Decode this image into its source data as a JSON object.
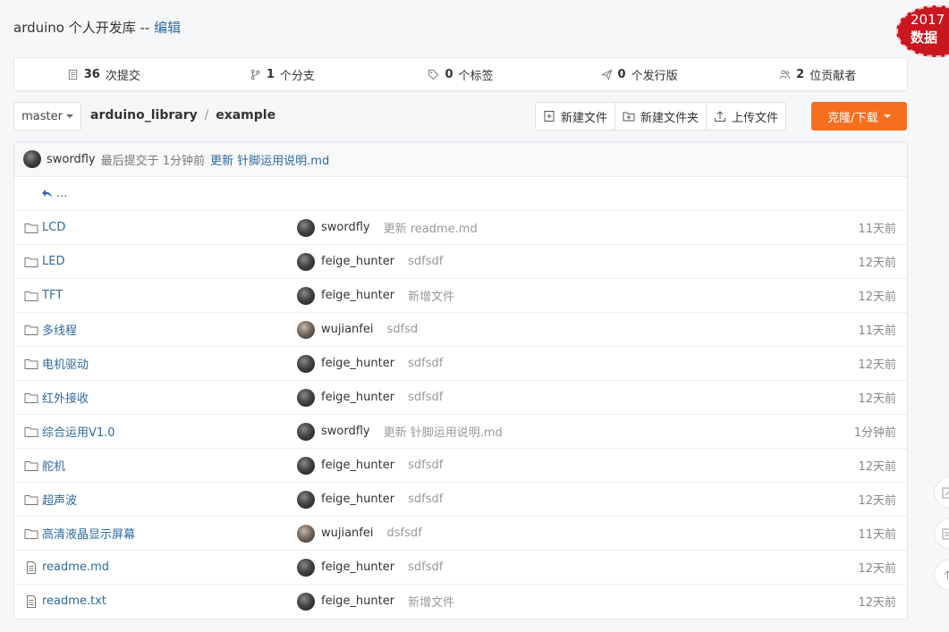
{
  "header": {
    "repo_title": "arduino 个人开发库 --",
    "edit_label": "编辑",
    "badge_year": "2017",
    "badge_text": "数据"
  },
  "stats": [
    {
      "icon": "commit-icon",
      "count": "36",
      "label": "次提交"
    },
    {
      "icon": "branch-icon",
      "count": "1",
      "label": "个分支"
    },
    {
      "icon": "tag-icon",
      "count": "0",
      "label": "个标签"
    },
    {
      "icon": "release-icon",
      "count": "0",
      "label": "个发行版"
    },
    {
      "icon": "contributors-icon",
      "count": "2",
      "label": "位贡献者"
    }
  ],
  "toolbar": {
    "branch": "master",
    "path": [
      "arduino_library",
      "example"
    ],
    "separator": "/",
    "new_file": "新建文件",
    "new_folder": "新建文件夹",
    "upload": "上传文件",
    "clone": "克隆/下载"
  },
  "last_commit": {
    "author": "swordfly",
    "prefix": "最后提交于 1分钟前",
    "message": "更新 针脚运用说明.md"
  },
  "up_label": "...",
  "files": [
    {
      "type": "folder",
      "name": "LCD",
      "author": "swordfly",
      "alt_avatar": false,
      "message": "更新 readme.md",
      "time": "11天前"
    },
    {
      "type": "folder",
      "name": "LED",
      "author": "feige_hunter",
      "alt_avatar": false,
      "message": "sdfsdf",
      "time": "12天前"
    },
    {
      "type": "folder",
      "name": "TFT",
      "author": "feige_hunter",
      "alt_avatar": false,
      "message": "新增文件",
      "time": "12天前"
    },
    {
      "type": "folder",
      "name": "多线程",
      "author": "wujianfei",
      "alt_avatar": true,
      "message": "sdfsd",
      "time": "11天前"
    },
    {
      "type": "folder",
      "name": "电机驱动",
      "author": "feige_hunter",
      "alt_avatar": false,
      "message": "sdfsdf",
      "time": "12天前"
    },
    {
      "type": "folder",
      "name": "红外接收",
      "author": "feige_hunter",
      "alt_avatar": false,
      "message": "sdfsdf",
      "time": "12天前"
    },
    {
      "type": "folder",
      "name": "综合运用V1.0",
      "author": "swordfly",
      "alt_avatar": false,
      "message": "更新 针脚运用说明.md",
      "time": "1分钟前"
    },
    {
      "type": "folder",
      "name": "舵机",
      "author": "feige_hunter",
      "alt_avatar": false,
      "message": "sdfsdf",
      "time": "12天前"
    },
    {
      "type": "folder",
      "name": "超声波",
      "author": "feige_hunter",
      "alt_avatar": false,
      "message": "sdfsdf",
      "time": "12天前"
    },
    {
      "type": "folder",
      "name": "高清液晶显示屏幕",
      "author": "wujianfei",
      "alt_avatar": true,
      "message": "dsfsdf",
      "time": "11天前"
    },
    {
      "type": "file",
      "name": "readme.md",
      "author": "feige_hunter",
      "alt_avatar": false,
      "message": "sdfsdf",
      "time": "12天前"
    },
    {
      "type": "file",
      "name": "readme.txt",
      "author": "feige_hunter",
      "alt_avatar": false,
      "message": "新增文件",
      "time": "12天前"
    }
  ],
  "colors": {
    "link": "#2e6a9e",
    "accent": "#f76e1e",
    "badge": "#c8171e"
  }
}
